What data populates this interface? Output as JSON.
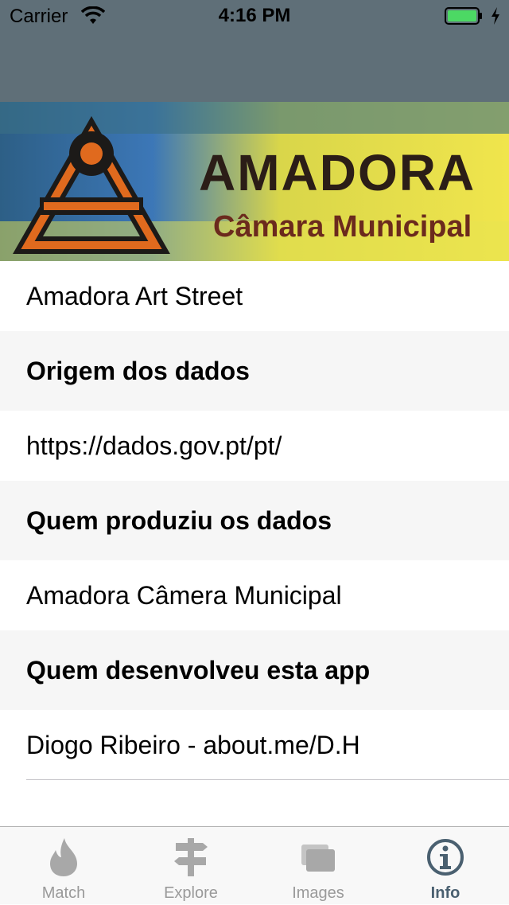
{
  "status_bar": {
    "carrier": "Carrier",
    "time": "4:16 PM",
    "battery_color": "#4cd964"
  },
  "banner": {
    "title": "AMADORA",
    "subtitle": "Câmara Municipal"
  },
  "list": {
    "app_name": "Amadora Art Street",
    "data_origin_header": "Origem dos dados",
    "data_origin_value": "https://dados.gov.pt/pt/",
    "producer_header": "Quem produziu os dados",
    "producer_value": "Amadora Câmera Municipal",
    "developer_header": "Quem desenvolveu esta app",
    "developer_value": "Diogo Ribeiro - about.me/D.H"
  },
  "tab_bar": {
    "tabs": [
      {
        "label": "Match",
        "icon": "flame-icon"
      },
      {
        "label": "Explore",
        "icon": "signpost-icon"
      },
      {
        "label": "Images",
        "icon": "images-icon"
      },
      {
        "label": "Info",
        "icon": "info-icon"
      }
    ],
    "active_tab": "Info",
    "active_color": "#4a6070",
    "inactive_color": "#9a9a9a"
  }
}
